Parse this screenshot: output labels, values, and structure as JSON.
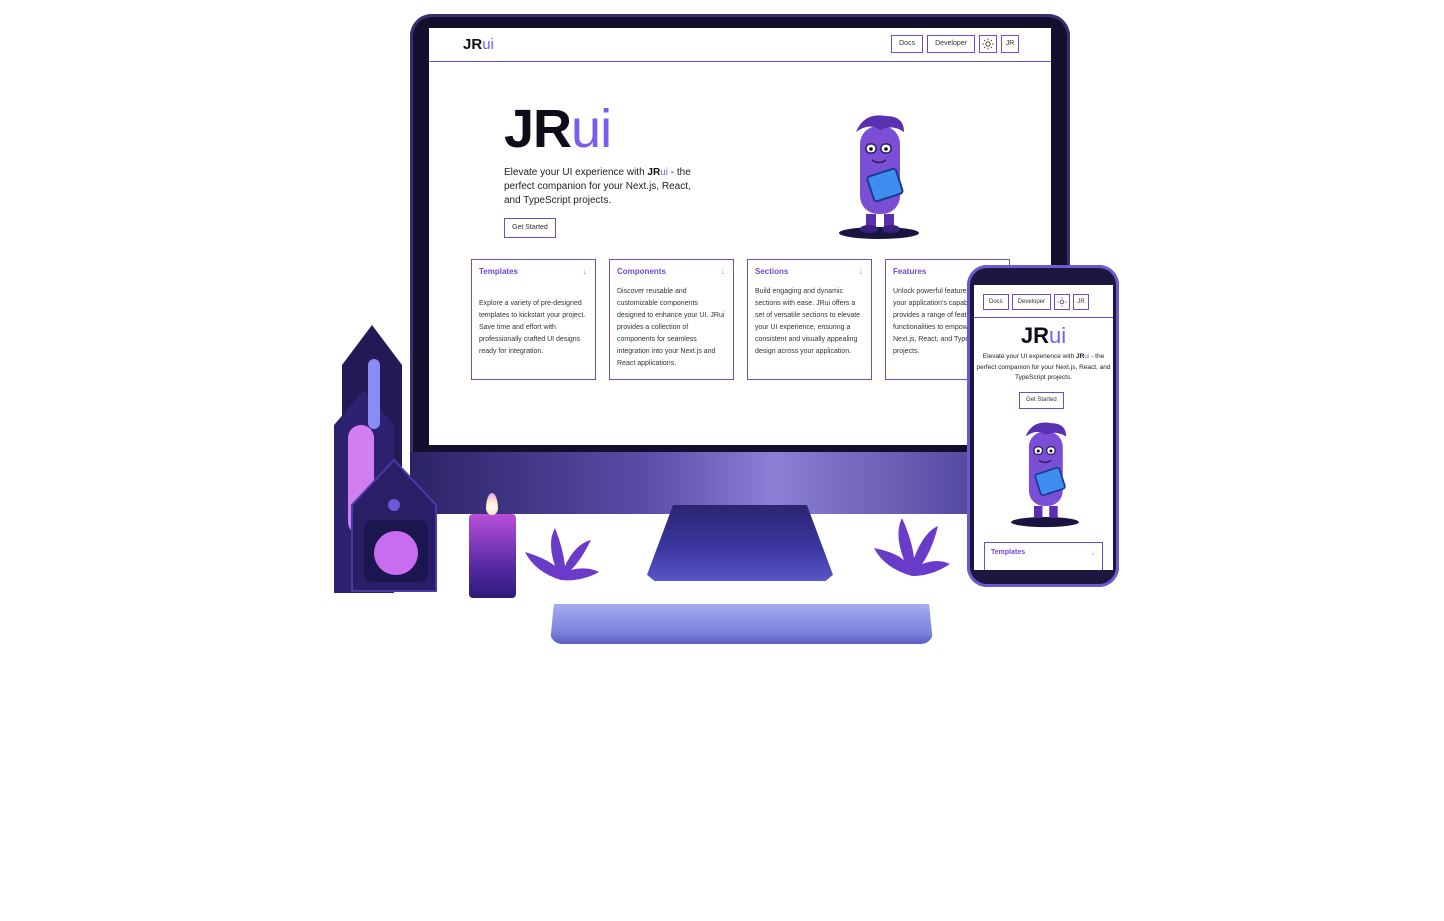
{
  "desktop": {
    "nav": {
      "logo_prefix": "JR",
      "logo_suffix": "ui",
      "docs_label": "Docs",
      "developer_label": "Developer",
      "theme_icon": "sun-icon",
      "avatar_label": "JR"
    },
    "hero": {
      "title_prefix": "JR",
      "title_suffix": "ui",
      "desc_before": "Elevate your UI experience with ",
      "desc_brand_prefix": "JR",
      "desc_brand_suffix": "ui",
      "desc_after": " - the perfect companion for your Next.js, React, and TypeScript projects.",
      "cta_label": "Get Started"
    },
    "cards": [
      {
        "title": "Templates",
        "text": "Explore a variety of pre-designed templates to kickstart your project. Save time and effort with professionally crafted UI designs ready for integration."
      },
      {
        "title": "Components",
        "text": "Discover reusable and customizable components designed to enhance your UI. JRui provides a collection of components for seamless integration into your Next.js and React applications."
      },
      {
        "title": "Sections",
        "text": "Build engaging and dynamic sections with ease. JRui offers a set of versatile sections to elevate your UI experience, ensuring a consistent and visually appealing design across your application."
      },
      {
        "title": "Features",
        "text": "Unlock powerful features to amplify your application's capabilities. JRui provides a range of features and functionalities to empower your Next.js, React, and TypeScript projects."
      }
    ]
  },
  "mobile": {
    "nav": {
      "docs_label": "Docs",
      "developer_label": "Developer",
      "theme_icon": "sun-icon",
      "avatar_label": "JR"
    },
    "hero": {
      "title_prefix": "JR",
      "title_suffix": "ui",
      "desc_before": "Elevate your UI experience with ",
      "desc_brand_prefix": "JR",
      "desc_brand_suffix": "ui",
      "desc_after": " - the perfect companion for your Next.js, React, and TypeScript projects.",
      "cta_label": "Get Started"
    },
    "card": {
      "title": "Templates"
    }
  },
  "colors": {
    "accent": "#7b5cf0",
    "border": "#6d4ad6",
    "device_frame": "#140f2c"
  }
}
